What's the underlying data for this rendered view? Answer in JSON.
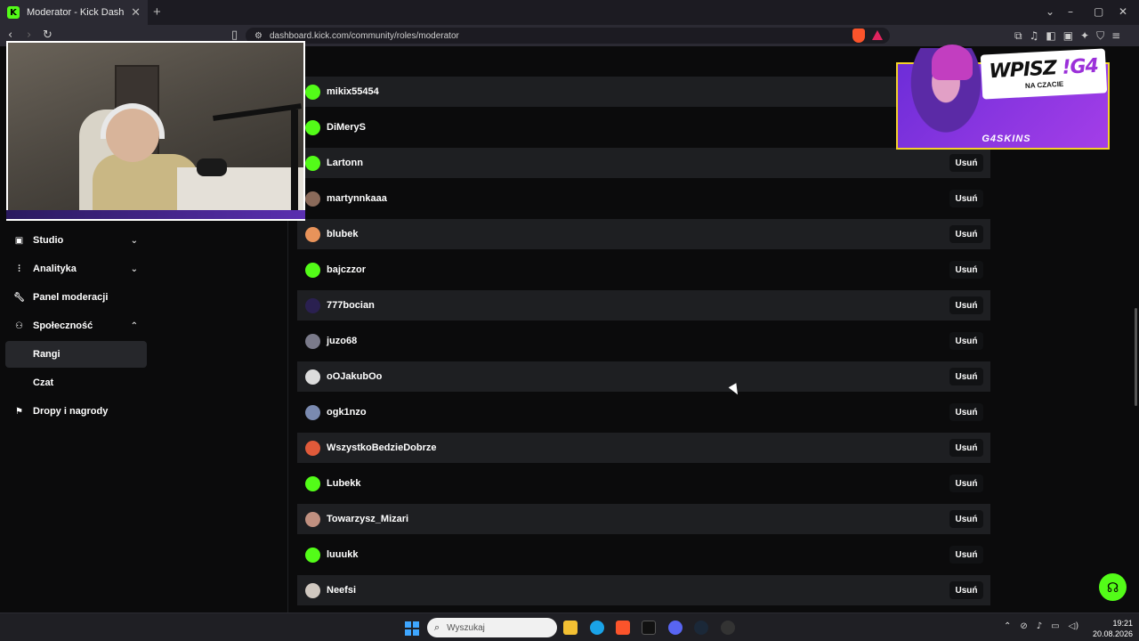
{
  "browser": {
    "tab_title": "Moderator - Kick Dashboard",
    "url": "dashboard.kick.com/community/roles/moderator"
  },
  "sidebar": {
    "items": [
      {
        "label": "Studio",
        "icon": "studio-icon",
        "chevron": "down"
      },
      {
        "label": "Analityka",
        "icon": "analytics-icon",
        "chevron": "down"
      },
      {
        "label": "Panel moderacji",
        "icon": "wrench-icon"
      },
      {
        "label": "Społeczność",
        "icon": "community-icon",
        "chevron": "up"
      },
      {
        "label": "Rangi",
        "active": true
      },
      {
        "label": "Czat"
      },
      {
        "label": "Dropy i nagrody",
        "icon": "gift-icon"
      }
    ]
  },
  "moderators": {
    "remove_label": "Usuń",
    "rows": [
      {
        "name": "mikix55454"
      },
      {
        "name": "DiMeryS"
      },
      {
        "name": "Lartonn"
      },
      {
        "name": "martynnkaaa"
      },
      {
        "name": "blubek"
      },
      {
        "name": "bajczzor"
      },
      {
        "name": "777bocian"
      },
      {
        "name": "juzo68"
      },
      {
        "name": "oOJakubOo"
      },
      {
        "name": "ogk1nzo"
      },
      {
        "name": "WszystkoBedzieDobrze"
      },
      {
        "name": "Lubekk"
      },
      {
        "name": "Towarzysz_Mizari"
      },
      {
        "name": "luuukk"
      },
      {
        "name": "Neefsi"
      }
    ]
  },
  "ad": {
    "title_prefix": "WPISZ ",
    "title_code": "!G4",
    "subtitle": "NA CZACIE",
    "brand": "G4SKINS"
  },
  "taskbar": {
    "search_placeholder": "Wyszukaj",
    "time": "19:21",
    "date": "20.08.2026"
  },
  "colors": {
    "accent": "#53fc18",
    "row_alt": "#1e1f22",
    "background": "#0b0b0c"
  }
}
